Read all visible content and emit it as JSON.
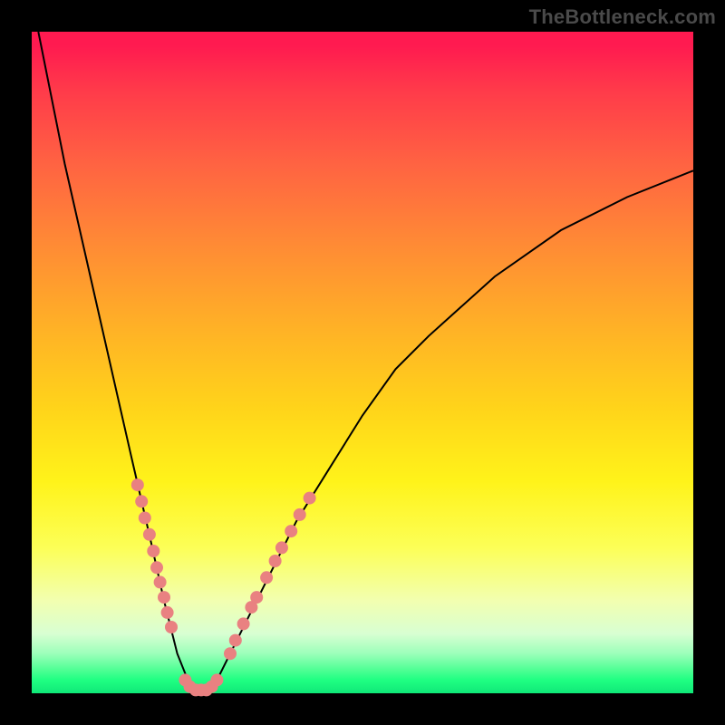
{
  "watermark": "TheBottleneck.com",
  "colors": {
    "frame": "#000000",
    "gradient_top": "#ff1a50",
    "gradient_bottom": "#10e878",
    "curve": "#000000",
    "points": "#e98181"
  },
  "chart_data": {
    "type": "line",
    "title": "",
    "xlabel": "",
    "ylabel": "",
    "xlim": [
      0,
      100
    ],
    "ylim": [
      0,
      100
    ],
    "grid": false,
    "notes": "V-shaped bottleneck curve; salmon dots highlight sample points near the valley on both branches.",
    "series": [
      {
        "name": "bottleneck-curve",
        "x": [
          1,
          5,
          10,
          15,
          18,
          20,
          22,
          24,
          25,
          26,
          27.5,
          30,
          35,
          40,
          45,
          50,
          55,
          60,
          70,
          80,
          90,
          100
        ],
        "y": [
          100,
          80,
          58,
          36,
          23,
          14,
          6,
          1,
          0,
          0,
          1,
          6,
          16,
          26,
          34,
          42,
          49,
          54,
          63,
          70,
          75,
          79
        ]
      }
    ],
    "highlight_points": [
      {
        "x": 16.0,
        "y": 31.5
      },
      {
        "x": 16.6,
        "y": 29.0
      },
      {
        "x": 17.1,
        "y": 26.5
      },
      {
        "x": 17.8,
        "y": 24.0
      },
      {
        "x": 18.4,
        "y": 21.5
      },
      {
        "x": 18.9,
        "y": 19.0
      },
      {
        "x": 19.4,
        "y": 16.8
      },
      {
        "x": 20.0,
        "y": 14.5
      },
      {
        "x": 20.5,
        "y": 12.2
      },
      {
        "x": 21.1,
        "y": 10.0
      },
      {
        "x": 23.2,
        "y": 2.0
      },
      {
        "x": 23.9,
        "y": 1.0
      },
      {
        "x": 24.8,
        "y": 0.5
      },
      {
        "x": 25.6,
        "y": 0.5
      },
      {
        "x": 26.4,
        "y": 0.5
      },
      {
        "x": 27.2,
        "y": 1.0
      },
      {
        "x": 28.0,
        "y": 2.0
      },
      {
        "x": 30.0,
        "y": 6.0
      },
      {
        "x": 30.8,
        "y": 8.0
      },
      {
        "x": 32.0,
        "y": 10.5
      },
      {
        "x": 33.2,
        "y": 13.0
      },
      {
        "x": 34.0,
        "y": 14.5
      },
      {
        "x": 35.5,
        "y": 17.5
      },
      {
        "x": 36.8,
        "y": 20.0
      },
      {
        "x": 37.8,
        "y": 22.0
      },
      {
        "x": 39.2,
        "y": 24.5
      },
      {
        "x": 40.5,
        "y": 27.0
      },
      {
        "x": 42.0,
        "y": 29.5
      }
    ]
  }
}
